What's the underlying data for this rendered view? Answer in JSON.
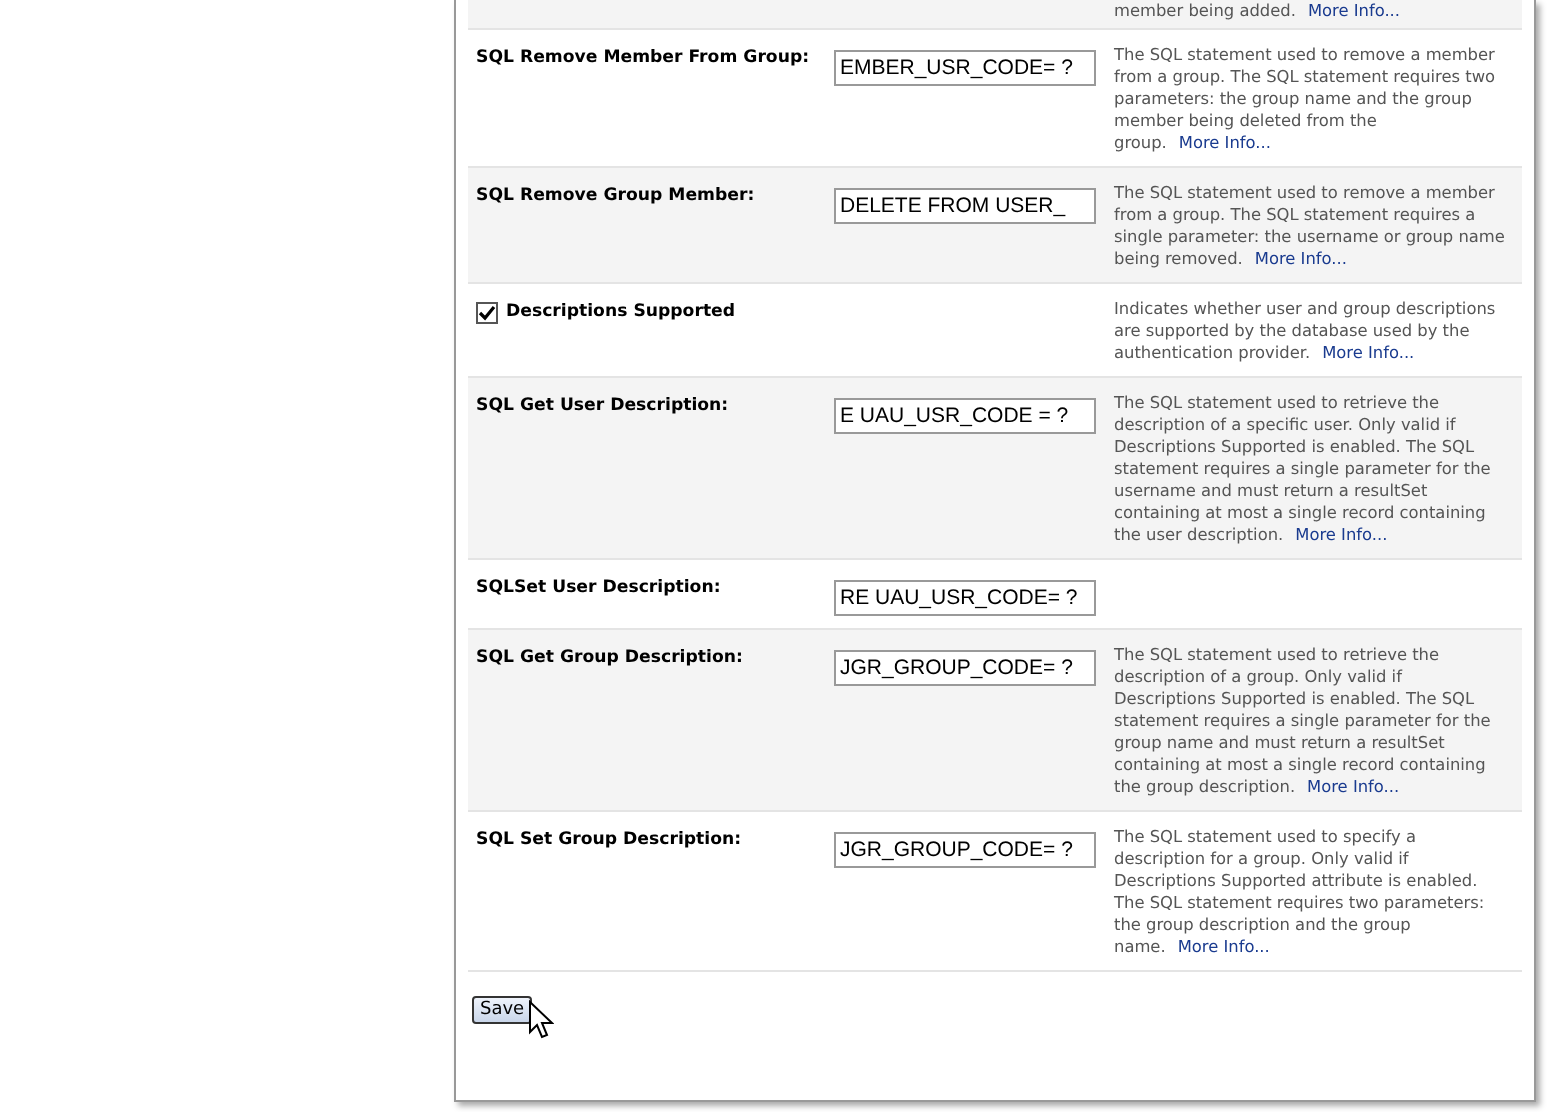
{
  "rows": [
    {
      "kind": "partial",
      "description": "member being added.",
      "more_info": "More Info..."
    },
    {
      "kind": "text",
      "label": "SQL Remove Member From Group:",
      "value": "EMBER_USR_CODE= ?",
      "description": "The SQL statement used to remove a member from a group. The SQL statement requires two parameters: the group name and the group member being deleted from the group.",
      "more_info": "More Info..."
    },
    {
      "kind": "text",
      "label": "SQL Remove Group Member:",
      "value": "DELETE FROM USER_",
      "description": "The SQL statement used to remove a member from a group. The SQL statement requires a single parameter: the username or group name being removed.",
      "more_info": "More Info..."
    },
    {
      "kind": "checkbox",
      "label": "Descriptions Supported",
      "checked": true,
      "description": "Indicates whether user and group descriptions are supported by the database used by the authentication provider.",
      "more_info": "More Info..."
    },
    {
      "kind": "text",
      "label": "SQL Get User Description:",
      "value": "E UAU_USR_CODE = ?",
      "description": "The SQL statement used to retrieve the description of a specific user. Only valid if Descriptions Supported is enabled. The SQL statement requires a single parameter for the username and must return a resultSet containing at most a single record containing the user description.",
      "more_info": "More Info..."
    },
    {
      "kind": "text",
      "label": "SQLSet User Description:",
      "value": "RE UAU_USR_CODE= ?"
    },
    {
      "kind": "text",
      "label": "SQL Get Group Description:",
      "value": "JGR_GROUP_CODE= ?",
      "description": "The SQL statement used to retrieve the description of a group. Only valid if Descriptions Supported is enabled. The SQL statement requires a single parameter for the group name and must return a resultSet containing at most a single record containing the group description.",
      "more_info": "More Info..."
    },
    {
      "kind": "text",
      "label": "SQL Set Group Description:",
      "value": "JGR_GROUP_CODE= ?",
      "description": "The SQL statement used to specify a description for a group. Only valid if Descriptions Supported attribute is enabled. The SQL statement requires two parameters: the group description and the group name.",
      "more_info": "More Info..."
    }
  ],
  "save_button": "Save"
}
